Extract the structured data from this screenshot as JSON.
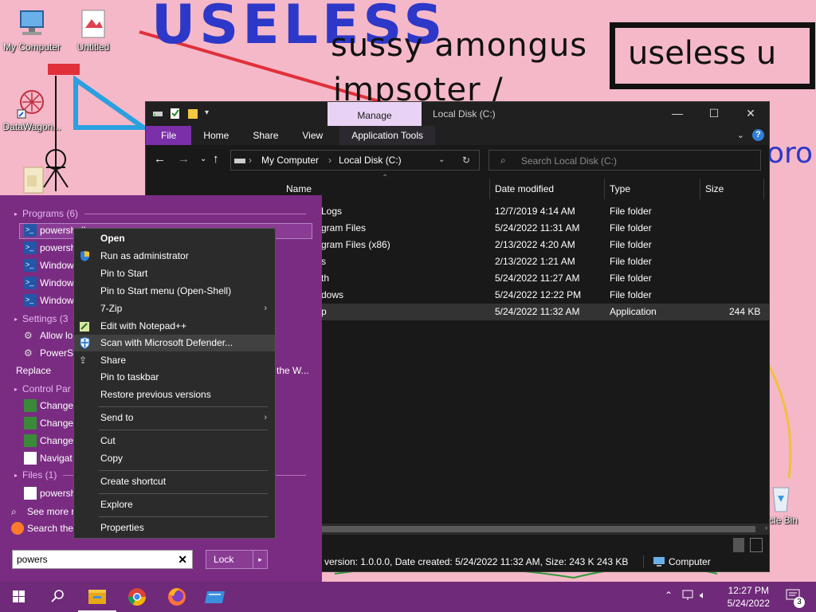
{
  "wallpaper": {
    "big_text": "USELESS",
    "sussy_text": "sussy amongus",
    "impsoter_text": "impsoter /",
    "box_text": "useless u",
    "pro_text": "oro"
  },
  "desktop_icons": {
    "my_computer": "My Computer",
    "untitled": "Untitled",
    "datawagon": "DataWagon...",
    "recycle_bin": "ycle Bin"
  },
  "explorer": {
    "manage_tab": "Manage",
    "window_title": "Local Disk (C:)",
    "ribbon_tabs": [
      "File",
      "Home",
      "Share",
      "View",
      "Application Tools"
    ],
    "address": {
      "root": "My Computer",
      "current": "Local Disk (C:)"
    },
    "search_placeholder": "Search Local Disk (C:)",
    "columns": {
      "name": "Name",
      "date": "Date modified",
      "type": "Type",
      "size": "Size"
    },
    "rows": [
      {
        "name": "Logs",
        "date": "12/7/2019 4:14 AM",
        "type": "File folder",
        "size": ""
      },
      {
        "name": "gram Files",
        "date": "5/24/2022 11:31 AM",
        "type": "File folder",
        "size": ""
      },
      {
        "name": "gram Files (x86)",
        "date": "2/13/2022 4:20 AM",
        "type": "File folder",
        "size": ""
      },
      {
        "name": "s",
        "date": "2/13/2022 1:21 AM",
        "type": "File folder",
        "size": ""
      },
      {
        "name": "th",
        "date": "5/24/2022 11:27 AM",
        "type": "File folder",
        "size": ""
      },
      {
        "name": "dows",
        "date": "5/24/2022 12:22 PM",
        "type": "File folder",
        "size": ""
      },
      {
        "name": "p",
        "date": "5/24/2022 11:32 AM",
        "type": "Application",
        "size": "244 KB"
      }
    ],
    "status_text": "version: 1.0.0.0, Date created: 5/24/2022 11:32 AM, Size: 243 K 243 KB",
    "status_location": "Computer"
  },
  "start_menu": {
    "categories": {
      "programs": "Programs (6)",
      "settings": "Settings (3",
      "control_panel": "Control Par",
      "files": "Files (1)"
    },
    "items": {
      "ps1": "powershell",
      "ps2": "powersh",
      "win1": "Window",
      "win2": "Window",
      "win3": "Window",
      "allow": "Allow lo",
      "powersh_set": "PowerSh",
      "replace": "Replace",
      "replace_tail": "the W...",
      "change1": "Change",
      "change2": "Change",
      "change3": "Change",
      "navigat": "Navigat",
      "file_ps": "powersh",
      "see_more": "See more re",
      "search_the": "Search the"
    },
    "search_value": "powers",
    "lock_label": "Lock"
  },
  "context_menu": {
    "items": [
      "Open",
      "Run as administrator",
      "Pin to Start",
      "Pin to Start menu (Open-Shell)",
      "7-Zip",
      "Edit with Notepad++",
      "Scan with Microsoft Defender...",
      "Share",
      "Pin to taskbar",
      "Restore previous versions",
      "Send to",
      "Cut",
      "Copy",
      "Create shortcut",
      "Explore",
      "Properties"
    ]
  },
  "taskbar": {
    "time": "12:27 PM",
    "date": "5/24/2022",
    "notification_count": "3"
  },
  "colors": {
    "wallpaper": "#f5b8c8",
    "start_menu": "#7a2c82",
    "taskbar": "#6f2a79",
    "explorer_bg": "#191919",
    "manage_tab": "#e9d3f5"
  }
}
